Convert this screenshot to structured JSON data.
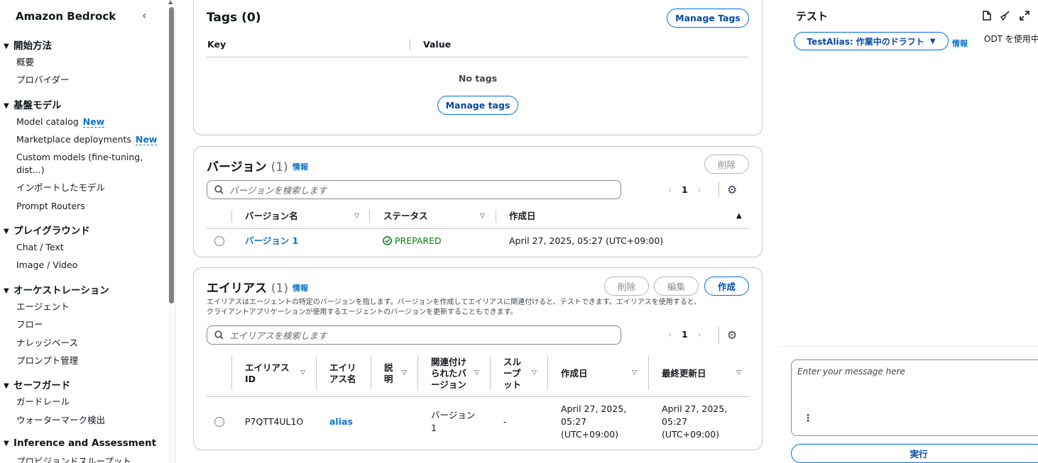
{
  "sidebar": {
    "title": "Amazon Bedrock",
    "sections": [
      {
        "label": "開始方法",
        "items": [
          {
            "label": "概要"
          },
          {
            "label": "プロバイダー"
          }
        ]
      },
      {
        "label": "基盤モデル",
        "items": [
          {
            "label": "Model catalog",
            "badge": "New"
          },
          {
            "label": "Marketplace deployments",
            "badge": "New"
          },
          {
            "label": "Custom models (fine-tuning,",
            "label2": "dist...)"
          },
          {
            "label": "インポートしたモデル"
          },
          {
            "label": "Prompt Routers"
          }
        ]
      },
      {
        "label": "プレイグラウンド",
        "items": [
          {
            "label": "Chat / Text"
          },
          {
            "label": "Image / Video"
          }
        ]
      },
      {
        "label": "オーケストレーション",
        "items": [
          {
            "label": "エージェント"
          },
          {
            "label": "フロー"
          },
          {
            "label": "ナレッジベース"
          },
          {
            "label": "プロンプト管理"
          }
        ]
      },
      {
        "label": "セーフガード",
        "items": [
          {
            "label": "ガードレール"
          },
          {
            "label": "ウォーターマーク検出"
          }
        ]
      },
      {
        "label": "Inference and Assessment",
        "items": [
          {
            "label": "プロビジョンドスループット"
          }
        ]
      }
    ]
  },
  "tags": {
    "title": "Tags",
    "count": "(0)",
    "manage_label": "Manage Tags",
    "col_key": "Key",
    "col_value": "Value",
    "empty": "No tags",
    "manage_tags_label": "Manage tags"
  },
  "versions": {
    "title": "バージョン",
    "count": "(1)",
    "info": "情報",
    "delete_label": "削除",
    "search_placeholder": "バージョンを検索します",
    "page": "1",
    "columns": [
      "バージョン名",
      "ステータス",
      "作成日"
    ],
    "rows": [
      {
        "name": "バージョン 1",
        "status": "PREPARED",
        "created": "April 27, 2025, 05:27 (UTC+09:00)"
      }
    ]
  },
  "aliases": {
    "title": "エイリアス",
    "count": "(1)",
    "info": "情報",
    "delete_label": "削除",
    "edit_label": "編集",
    "create_label": "作成",
    "description_line1": "エイリアスはエージェントの特定のバージョンを指します。バージョンを作成してエイリアスに関連付けると、テストできます。エイリアスを使用すると、",
    "description_line2": "クライアントアプリケーションが使用するエージェントのバージョンを更新することもできます。",
    "search_placeholder": "エイリアスを検索します",
    "page": "1",
    "columns": [
      [
        "エイリアス",
        "ID"
      ],
      [
        "エイリ",
        "アス名"
      ],
      [
        "説",
        "明"
      ],
      [
        "関連付け",
        "られたバ",
        "ージョン"
      ],
      [
        "スル",
        "ープ",
        "ット"
      ],
      [
        "作成日"
      ],
      [
        "最終更新日"
      ]
    ],
    "rows": [
      {
        "id": "P7QTT4UL1O",
        "name": "alias",
        "description": "",
        "version_l1": "バージョン",
        "version_l2": "1",
        "throughput": "-",
        "created_l1": "April 27, 2025,",
        "created_l2": "05:27",
        "created_l3": "(UTC+09:00)",
        "updated_l1": "April 27, 2025,",
        "updated_l2": "05:27",
        "updated_l3": "(UTC+09:00)"
      }
    ]
  },
  "test": {
    "title": "テスト",
    "alias_dropdown": "TestAlias: 作業中のドラフト",
    "info": "情報",
    "odt_text": "ODT を使用中",
    "message_placeholder": "Enter your message here",
    "run_label": "実行"
  },
  "colors": {
    "accent": "#006ce0",
    "link": "#0972d3",
    "success": "#037f0c",
    "border": "#c6c6cd"
  }
}
